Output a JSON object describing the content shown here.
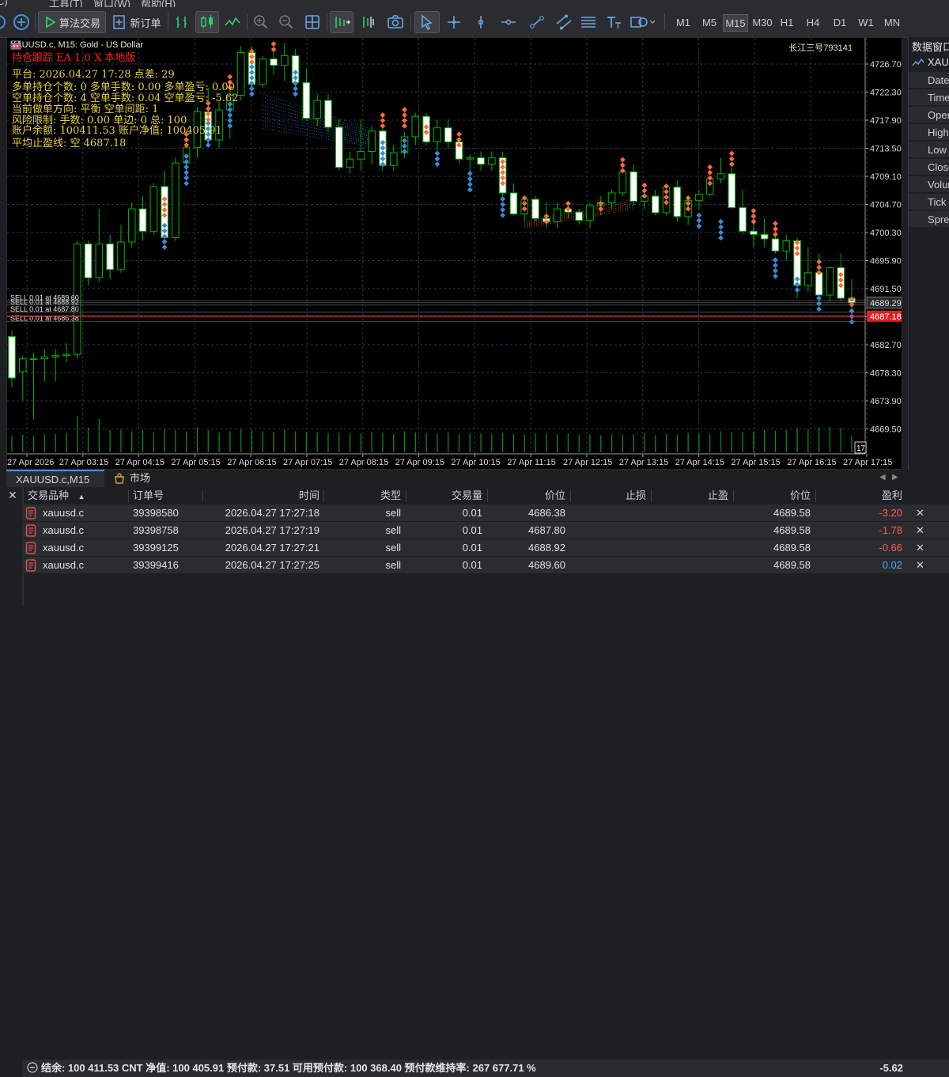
{
  "menu": {
    "items": [
      "工具(T)",
      "窗口(W)",
      "帮助(H)"
    ]
  },
  "toolbar": {
    "algo_trading": "算法交易",
    "new_order": "新订单",
    "timeframes": [
      "M1",
      "M5",
      "M15",
      "M30",
      "H1",
      "H4",
      "D1",
      "W1",
      "MN"
    ],
    "active_timeframe": "M15"
  },
  "chart": {
    "header": "XAUUSD.c, M15:  Gold - US Dollar",
    "account_label": "长江三号793141",
    "ea_title": "持仓跟踪   EA 1.0   X 本地版",
    "overlay_lines": [
      "平台: 2026.04.27 17:28      点差: 29",
      "多单持仓个数: 0  多单手数: 0.00  多单盈亏: 0.00",
      "空单持仓个数: 4  空单手数: 0.04  空单盈亏: -5.62",
      "当前做单方向: 平衡   空单间距: 1",
      "风险限制: 手数: 0.00  单边: 0  总: 100",
      "账户余额: 100411.53  账户净值: 100405.91",
      "平均止盈线: 空 4687.18"
    ],
    "order_labels": [
      "SELL 0.01 at 4689.60",
      "SELL 0.01 at 4688.92",
      "SELL 0.01 at 4687.80",
      "SELL 0.01 at 4686.38"
    ],
    "price_axis": [
      "4726.70",
      "4722.30",
      "4717.90",
      "4713.50",
      "4709.10",
      "4704.70",
      "4700.30",
      "4695.90",
      "4691.50",
      "4687.10",
      "4682.70",
      "4678.30",
      "4673.90",
      "4669.50"
    ],
    "price_badges": {
      "bid": "4689.29",
      "avg_tp": "4687.18"
    },
    "volume_box": "17",
    "time_axis": [
      "27 Apr 2026",
      "27 Apr 03:15",
      "27 Apr 04:15",
      "27 Apr 05:15",
      "27 Apr 06:15",
      "27 Apr 07:15",
      "27 Apr 08:15",
      "27 Apr 09:15",
      "27 Apr 10:15",
      "27 Apr 11:15",
      "27 Apr 12:15",
      "27 Apr 13:15",
      "27 Apr 14:15",
      "27 Apr 15:15",
      "27 Apr 16:15",
      "27 Apr 17:15"
    ],
    "colors": {
      "bull": "#00b400",
      "bear_fill": "#ffffff",
      "grid": "#2a3550",
      "avg_line": "#ff2b2b",
      "order_line": "#6b6b6b",
      "overlay_text": "#e5d13c",
      "ea_title": "#ff2020",
      "sell_marker": "#ff6a3d",
      "buy_marker": "#3a8ad8"
    },
    "candles": [
      [
        4684,
        4685,
        4676,
        4677.5
      ],
      [
        4678.5,
        4681,
        4674,
        4680.5
      ],
      [
        4680.5,
        4681.5,
        4671,
        4680.5
      ],
      [
        4680.5,
        4682,
        4677,
        4680.8
      ],
      [
        4680.8,
        4682,
        4677,
        4681
      ],
      [
        4681,
        4683,
        4680,
        4681.2
      ],
      [
        4681.2,
        4699,
        4680.5,
        4698.5
      ],
      [
        4698.5,
        4699,
        4692,
        4693.2
      ],
      [
        4693.2,
        4704,
        4692.5,
        4698.5
      ],
      [
        4698.5,
        4700,
        4693,
        4694.5
      ],
      [
        4694.5,
        4701.5,
        4694,
        4698.8
      ],
      [
        4698.8,
        4705,
        4698,
        4704
      ],
      [
        4704,
        4706,
        4699,
        4700.5
      ],
      [
        4700.5,
        4708,
        4700,
        4707.5
      ],
      [
        4707.5,
        4710,
        4699,
        4699.5
      ],
      [
        4699.5,
        4712,
        4699,
        4711.2
      ],
      [
        4711.2,
        4715,
        4709,
        4713.6
      ],
      [
        4713.6,
        4720,
        4712,
        4719.2
      ],
      [
        4719.2,
        4723,
        4714,
        4714.8
      ],
      [
        4714.8,
        4721,
        4713.5,
        4719.5
      ],
      [
        4719.5,
        4723,
        4715,
        4721.8
      ],
      [
        4721.8,
        4729.5,
        4721,
        4728.5
      ],
      [
        4728.5,
        4729.5,
        4723,
        4723.5
      ],
      [
        4723.5,
        4728,
        4723,
        4727.5
      ],
      [
        4727.5,
        4729,
        4725,
        4726.5
      ],
      [
        4726.5,
        4730,
        4724,
        4728
      ],
      [
        4728,
        4729,
        4723,
        4723.8
      ],
      [
        4723.8,
        4726,
        4718,
        4718.2
      ],
      [
        4718.2,
        4722,
        4717,
        4721
      ],
      [
        4721,
        4722,
        4716,
        4716.8
      ],
      [
        4716.8,
        4718,
        4710,
        4710.5
      ],
      [
        4710.5,
        4713,
        4709.5,
        4711.8
      ],
      [
        4711.8,
        4718,
        4710,
        4713
      ],
      [
        4713,
        4717,
        4711,
        4716.2
      ],
      [
        4716.2,
        4717,
        4710,
        4710.8
      ],
      [
        4710.8,
        4714,
        4710,
        4712.8
      ],
      [
        4712.8,
        4716,
        4712,
        4715.3
      ],
      [
        4715.3,
        4719,
        4714,
        4718.5
      ],
      [
        4718.5,
        4719,
        4714,
        4714.5
      ],
      [
        4714.5,
        4718,
        4713,
        4716.7
      ],
      [
        4716.7,
        4718,
        4713.5,
        4714.5
      ],
      [
        4714.5,
        4715,
        4711,
        4711.8
      ],
      [
        4711.8,
        4712.5,
        4707,
        4712
      ],
      [
        4712,
        4713,
        4710,
        4711
      ],
      [
        4711,
        4713,
        4710,
        4712
      ],
      [
        4712,
        4713,
        4706,
        4706.5
      ],
      [
        4706.5,
        4708,
        4703,
        4703.2
      ],
      [
        4703.2,
        4706,
        4702,
        4705.5
      ],
      [
        4705.5,
        4706,
        4702,
        4702.5
      ],
      [
        4702.5,
        4705,
        4701,
        4702
      ],
      [
        4702,
        4705,
        4701,
        4704
      ],
      [
        4704,
        4705,
        4702.5,
        4703.5
      ],
      [
        4703.5,
        4704,
        4701.5,
        4702.2
      ],
      [
        4702.2,
        4705,
        4701,
        4704.5
      ],
      [
        4704.5,
        4706,
        4703,
        4705
      ],
      [
        4705,
        4707,
        4704,
        4706.5
      ],
      [
        4706.5,
        4710.5,
        4706,
        4709.8
      ],
      [
        4709.8,
        4711,
        4704.5,
        4705.2
      ],
      [
        4705.2,
        4708,
        4704,
        4706
      ],
      [
        4706,
        4707,
        4703,
        4703.4
      ],
      [
        4703.4,
        4708,
        4703,
        4707.4
      ],
      [
        4707.4,
        4708.5,
        4702,
        4702.8
      ],
      [
        4702.8,
        4706,
        4701.5,
        4705.3
      ],
      [
        4705.3,
        4707,
        4704,
        4706.3
      ],
      [
        4706.3,
        4709,
        4706,
        4708.7
      ],
      [
        4708.7,
        4712,
        4708,
        4709.5
      ],
      [
        4709.5,
        4710.5,
        4704,
        4704.2
      ],
      [
        4704.2,
        4707,
        4700,
        4700.5
      ],
      [
        4700.5,
        4703,
        4698,
        4700
      ],
      [
        4700,
        4702.5,
        4698,
        4699.3
      ],
      [
        4699.3,
        4702,
        4697,
        4697.4
      ],
      [
        4697.4,
        4700,
        4696,
        4699
      ],
      [
        4699,
        4699.5,
        4690,
        4692
      ],
      [
        4692,
        4698,
        4691,
        4694
      ],
      [
        4694,
        4697,
        4689.5,
        4690.5
      ],
      [
        4690.5,
        4695,
        4689.5,
        4694.8
      ],
      [
        4694.8,
        4697,
        4689.5,
        4690
      ],
      [
        4690,
        4693,
        4686.5,
        4689.3
      ]
    ],
    "volumes": [
      0.3,
      0.32,
      0.3,
      0.33,
      0.33,
      0.35,
      0.65,
      0.45,
      0.6,
      0.4,
      0.42,
      0.38,
      0.4,
      0.36,
      0.42,
      0.4,
      0.38,
      0.45,
      0.4,
      0.36,
      0.38,
      0.42,
      0.4,
      0.38,
      0.37,
      0.4,
      0.38,
      0.36,
      0.36,
      0.35,
      0.36,
      0.35,
      0.34,
      0.37,
      0.35,
      0.33,
      0.38,
      0.36,
      0.35,
      0.33,
      0.36,
      0.33,
      0.35,
      0.34,
      0.33,
      0.35,
      0.33,
      0.32,
      0.34,
      0.33,
      0.33,
      0.34,
      0.32,
      0.32,
      0.31,
      0.33,
      0.32,
      0.33,
      0.34,
      0.31,
      0.33,
      0.32,
      0.35,
      0.34,
      0.33,
      0.38,
      0.36,
      0.37,
      0.38,
      0.4,
      0.39,
      0.4,
      0.44,
      0.42,
      0.45,
      0.46,
      0.44,
      0.3
    ]
  },
  "data_window": {
    "title": "数据窗口",
    "symbol": "XAU",
    "rows": [
      "Date",
      "Time",
      "Open",
      "High",
      "Low",
      "Close",
      "Volume",
      "Tick",
      "Spread"
    ]
  },
  "tabs": {
    "symbol": "XAUUSD.c,M15",
    "market": "市场"
  },
  "table": {
    "headers": [
      "交易品种",
      "订单号",
      "时间",
      "类型",
      "交易量",
      "价位",
      "止损",
      "止盈",
      "价位",
      "盈利"
    ],
    "rows": [
      {
        "symbol": "xauusd.c",
        "order": "39398580",
        "time": "2026.04.27 17:27:18",
        "type": "sell",
        "volume": "0.01",
        "price": "4686.38",
        "sl": "",
        "tp": "",
        "cur": "4689.58",
        "profit": "-3.20",
        "neg": true
      },
      {
        "symbol": "xauusd.c",
        "order": "39398758",
        "time": "2026.04.27 17:27:19",
        "type": "sell",
        "volume": "0.01",
        "price": "4687.80",
        "sl": "",
        "tp": "",
        "cur": "4689.58",
        "profit": "-1.78",
        "neg": true
      },
      {
        "symbol": "xauusd.c",
        "order": "39399125",
        "time": "2026.04.27 17:27:21",
        "type": "sell",
        "volume": "0.01",
        "price": "4688.92",
        "sl": "",
        "tp": "",
        "cur": "4689.58",
        "profit": "-0.66",
        "neg": true
      },
      {
        "symbol": "xauusd.c",
        "order": "39399416",
        "time": "2026.04.27 17:27:25",
        "type": "sell",
        "volume": "0.01",
        "price": "4689.60",
        "sl": "",
        "tp": "",
        "cur": "4689.58",
        "profit": "0.02",
        "neg": false
      }
    ],
    "summary": "结余: 100 411.53 CNT  净值: 100 405.91  预付款: 37.51  可用预付款: 100 368.40  预付款维持率: 267 677.71 %",
    "summary_total": "-5.62"
  }
}
